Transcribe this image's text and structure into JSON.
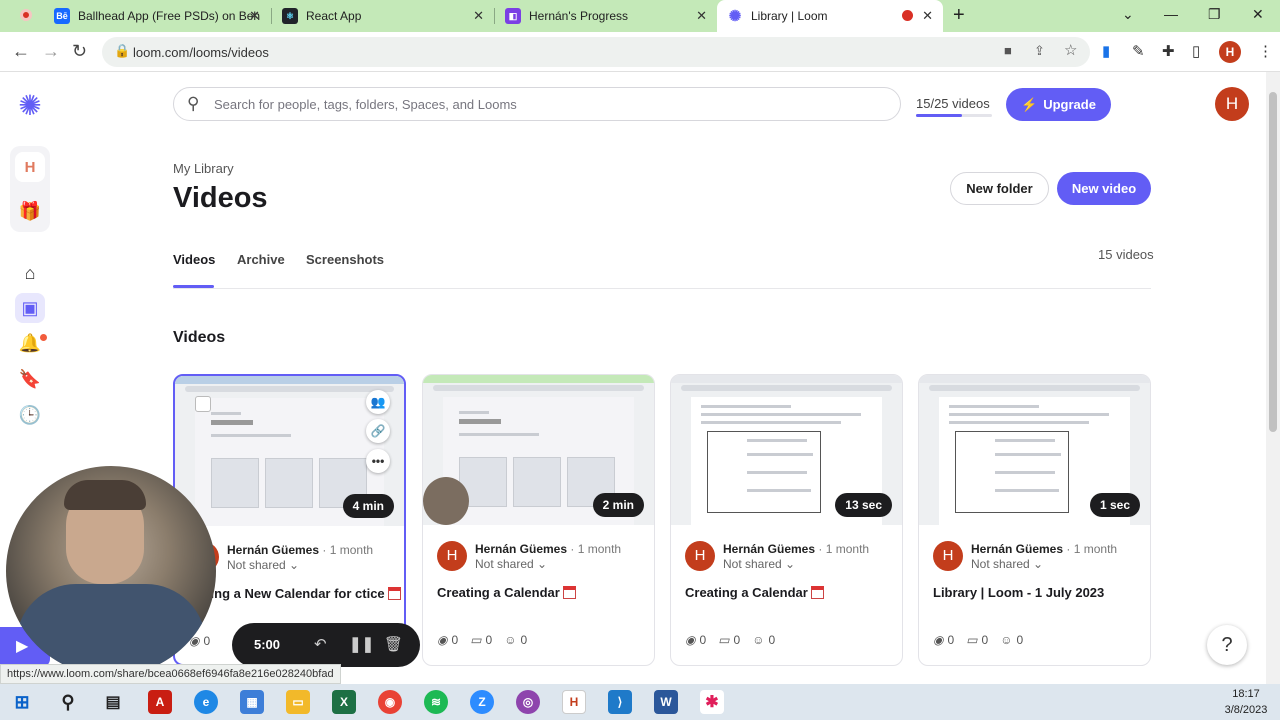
{
  "browser": {
    "tabs": [
      {
        "title": "Ballhead App (Free PSDs) on Beh",
        "favicon": "behance-icon",
        "color": "#1769ff"
      },
      {
        "title": "React App",
        "favicon": "react-icon",
        "color": "#20232a"
      },
      {
        "title": "Hernán's Progress",
        "favicon": "notion-icon",
        "color": "#7b3fe4"
      },
      {
        "title": "Library | Loom",
        "favicon": "loom-icon",
        "color": "#625df5"
      }
    ],
    "url": "loom.com/looms/videos",
    "profile_initial": "H"
  },
  "header": {
    "search_placeholder": "Search for people, tags, folders, Spaces, and Looms",
    "quota": "15/25 videos",
    "quota_fraction": 0.6,
    "upgrade_label": "Upgrade",
    "avatar_initial": "H"
  },
  "rail": {
    "workspace_initial": "H"
  },
  "library": {
    "breadcrumb": "My Library",
    "title": "Videos",
    "new_folder_label": "New folder",
    "new_video_label": "New video",
    "tabs": [
      "Videos",
      "Archive",
      "Screenshots"
    ],
    "video_count": "15 videos",
    "section_title": "Videos"
  },
  "videos": [
    {
      "author": "Hernán Güemes",
      "ago": "· 1 month",
      "shared": "Not shared",
      "title": "ating a New Calendar for ctice",
      "duration": "4 min",
      "views": "0",
      "comments": "0",
      "reactions": "0",
      "avatar": "H"
    },
    {
      "author": "Hernán Güemes",
      "ago": "· 1 month",
      "shared": "Not shared",
      "title": "Creating a Calendar",
      "duration": "2 min",
      "views": "0",
      "comments": "0",
      "reactions": "0",
      "avatar": "H"
    },
    {
      "author": "Hernán Güemes",
      "ago": "· 1 month",
      "shared": "Not shared",
      "title": "Creating a Calendar",
      "duration": "13 sec",
      "views": "0",
      "comments": "0",
      "reactions": "0",
      "avatar": "H"
    },
    {
      "author": "Hernán Güemes",
      "ago": "· 1 month",
      "shared": "Not shared",
      "title": "Library | Loom - 1 July 2023",
      "duration": "1 sec",
      "views": "0",
      "comments": "0",
      "reactions": "0",
      "avatar": "H"
    }
  ],
  "recorder": {
    "time": "5:00"
  },
  "status_url": "https://www.loom.com/share/bcea0668ef6946fa8e216e028240bfad",
  "taskbar": {
    "time": "18:17",
    "date": "3/8/2023"
  },
  "colors": {
    "accent": "#625df5",
    "avatar": "#c33d1c",
    "tabstrip": "#c4e9b8"
  }
}
